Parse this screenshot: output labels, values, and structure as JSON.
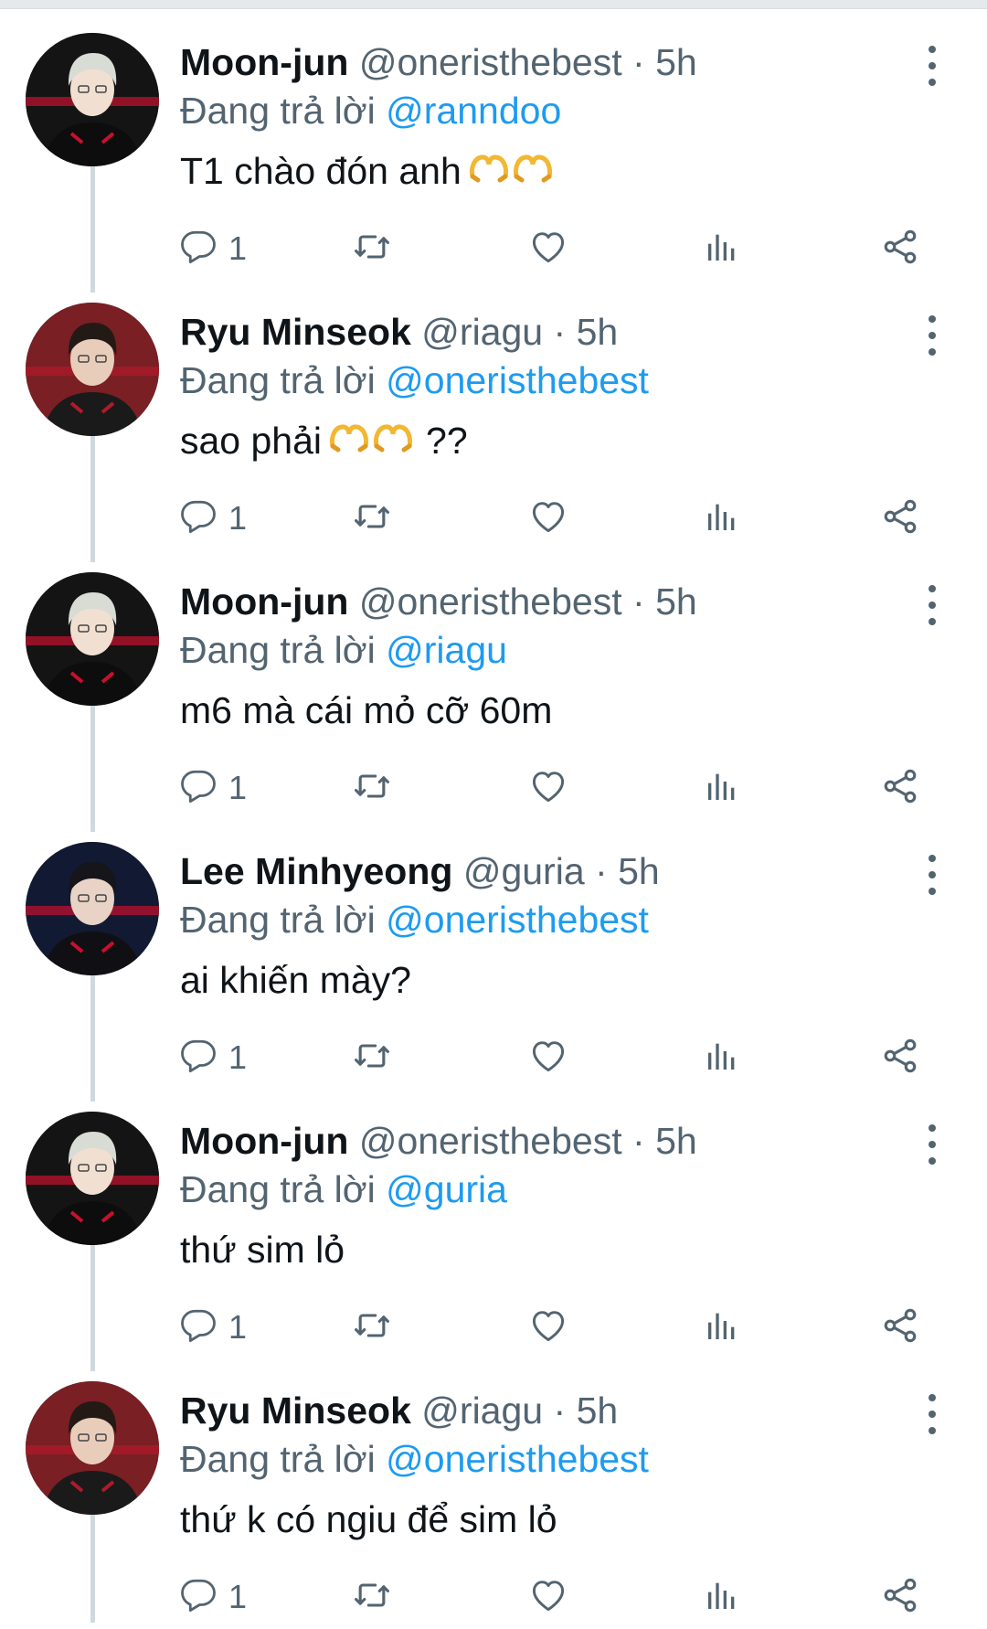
{
  "colors": {
    "link": "#1d9bf0",
    "secondary_text": "#536471",
    "primary_text": "#0f1419",
    "thread_line": "#cfd9de"
  },
  "icons": {
    "more": "more-vertical-icon",
    "reply": "reply-icon",
    "retweet": "retweet-icon",
    "like": "heart-icon",
    "views": "views-chart-icon",
    "share": "share-icon",
    "emoji": "heart-hands-emoji"
  },
  "tweets": [
    {
      "name": "Moon-jun",
      "handle": "@oneristhebest",
      "sep": "·",
      "time": "5h",
      "reply_prefix": "Đang trả lời",
      "reply_to": "@ranndoo",
      "text": "T1 chào đón anh",
      "emoji_count": 2,
      "text_after": "",
      "reply_count": "1"
    },
    {
      "name": "Ryu Minseok",
      "handle": "@riagu",
      "sep": "·",
      "time": "5h",
      "reply_prefix": "Đang trả lời",
      "reply_to": "@oneristhebest",
      "text": "sao phải",
      "emoji_count": 2,
      "text_after": "??",
      "reply_count": "1"
    },
    {
      "name": "Moon-jun",
      "handle": "@oneristhebest",
      "sep": "·",
      "time": "5h",
      "reply_prefix": "Đang trả lời",
      "reply_to": "@riagu",
      "text": "m6 mà cái mỏ cỡ 60m",
      "emoji_count": 0,
      "text_after": "",
      "reply_count": "1"
    },
    {
      "name": "Lee Minhyeong",
      "handle": "@guria",
      "sep": "·",
      "time": "5h",
      "reply_prefix": "Đang trả lời",
      "reply_to": "@oneristhebest",
      "text": "ai khiến mày?",
      "emoji_count": 0,
      "text_after": "",
      "reply_count": "1"
    },
    {
      "name": "Moon-jun",
      "handle": "@oneristhebest",
      "sep": "·",
      "time": "5h",
      "reply_prefix": "Đang trả lời",
      "reply_to": "@guria",
      "text": "thứ sim lỏ",
      "emoji_count": 0,
      "text_after": "",
      "reply_count": "1"
    },
    {
      "name": "Ryu Minseok",
      "handle": "@riagu",
      "sep": "·",
      "time": "5h",
      "reply_prefix": "Đang trả lời",
      "reply_to": "@oneristhebest",
      "text": "thứ k có ngiu để sim lỏ",
      "emoji_count": 0,
      "text_after": "",
      "reply_count": "1"
    }
  ]
}
